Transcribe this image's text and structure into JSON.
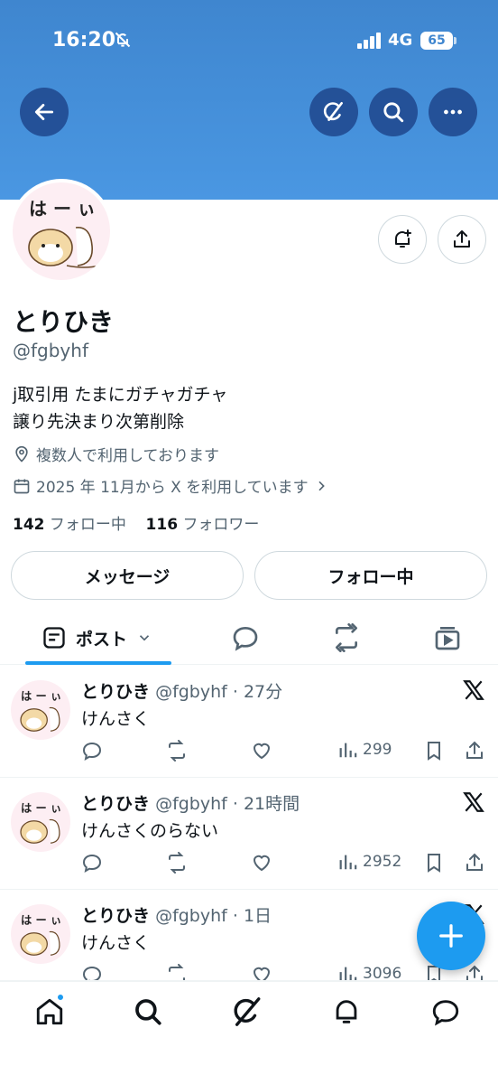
{
  "status_bar": {
    "time": "16:20",
    "network": "4G",
    "battery": "65"
  },
  "header": {
    "back_icon": "arrow-left-icon",
    "grok_icon": "grok-icon",
    "search_icon": "search-icon",
    "more_icon": "more-horizontal-icon"
  },
  "profile": {
    "name": "とりひき",
    "handle": "@fgbyhf",
    "bio_lines": [
      "j取引用 たまにガチャガチャ",
      "譲り先決まり次第削除"
    ],
    "location": "複数人で利用しております",
    "joined": "2025 年 11月から X を利用しています",
    "following_count": "142",
    "following_label": "フォロー中",
    "followers_count": "116",
    "followers_label": "フォロワー",
    "message_button": "メッセージ",
    "follow_button": "フォロー中"
  },
  "tabs": {
    "posts_label": "ポスト"
  },
  "posts": [
    {
      "name": "とりひき",
      "meta": "@fgbyhf · 27分",
      "text": "けんさく",
      "views": "299"
    },
    {
      "name": "とりひき",
      "meta": "@fgbyhf · 21時間",
      "text": "けんさくのらない",
      "views": "2952"
    },
    {
      "name": "とりひき",
      "meta": "@fgbyhf · 1日",
      "text": "けんさく",
      "views": "3096"
    }
  ],
  "colors": {
    "accent": "#1d9bf0",
    "header": "#4a97e2",
    "secondary_text": "#536471"
  }
}
